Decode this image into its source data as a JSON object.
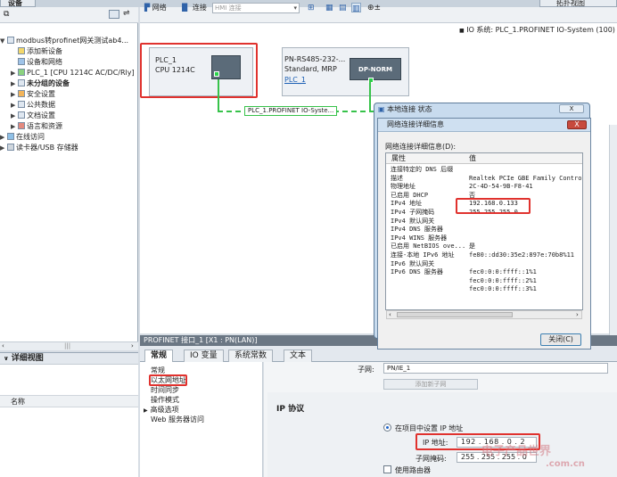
{
  "tabs": {
    "devices": "设备",
    "topology": "拓扑视图"
  },
  "tree": {
    "items": [
      {
        "label": "modbus转profinet网关测试ab4...",
        "indent": 0,
        "expander": "▼"
      },
      {
        "label": "添加新设备",
        "indent": 1,
        "expander": ""
      },
      {
        "label": "设备和网络",
        "indent": 1,
        "expander": ""
      },
      {
        "label": "PLC_1 [CPU 1214C AC/DC/Rly]",
        "indent": 1,
        "expander": "▶"
      },
      {
        "label": "未分组的设备",
        "indent": 1,
        "expander": "▶"
      },
      {
        "label": "安全设置",
        "indent": 1,
        "expander": "▶"
      },
      {
        "label": "公共数据",
        "indent": 1,
        "expander": "▶"
      },
      {
        "label": "文档设置",
        "indent": 1,
        "expander": "▶"
      },
      {
        "label": "语言和资源",
        "indent": 1,
        "expander": "▶"
      },
      {
        "label": "在线访问",
        "indent": 0,
        "expander": "▶"
      },
      {
        "label": "读卡器/USB 存储器",
        "indent": 0,
        "expander": "▶"
      }
    ]
  },
  "detail": {
    "title": "详细视图",
    "column": "名称"
  },
  "toolbar": {
    "network": "网络",
    "connections": "连接",
    "hmi_placeholder": "HMI 连接"
  },
  "io_system": "IO 系统: PLC_1.PROFINET IO-System (100)",
  "devices": {
    "plc": {
      "name": "PLC_1",
      "model": "CPU 1214C"
    },
    "dpn": {
      "name": "PN-RS485-232-...",
      "type": "Standard, MRP",
      "link": "PLC_1",
      "module": "DP-NORM"
    }
  },
  "bus_label": "PLC_1.PROFINET IO-Syste...",
  "dialog_outer": {
    "title": "本地连接 状态",
    "close": "X"
  },
  "dialog_inner": {
    "title": "网络连接详细信息",
    "close": "X",
    "caption": "网络连接详细信息(D):",
    "col_prop": "属性",
    "col_val": "值",
    "rows": [
      {
        "p": "连接特定的 DNS 后缀",
        "v": ""
      },
      {
        "p": "描述",
        "v": "Realtek PCIe GBE Family Controller"
      },
      {
        "p": "物理地址",
        "v": "2C-4D-54-9B-F8-41"
      },
      {
        "p": "已启用 DHCP",
        "v": "否"
      },
      {
        "p": "IPv4 地址",
        "v": "192.168.0.133"
      },
      {
        "p": "IPv4 子网掩码",
        "v": "255.255.255.0"
      },
      {
        "p": "IPv4 默认网关",
        "v": ""
      },
      {
        "p": "IPv4 DNS 服务器",
        "v": ""
      },
      {
        "p": "IPv4 WINS 服务器",
        "v": ""
      },
      {
        "p": "已启用 NetBIOS ove...",
        "v": "是"
      },
      {
        "p": "连接-本地 IPv6 地址",
        "v": "fe80::dd30:35e2:897e:70b8%11"
      },
      {
        "p": "IPv6 默认网关",
        "v": ""
      },
      {
        "p": "IPv6 DNS 服务器",
        "v": "fec0:0:0:ffff::1%1"
      },
      {
        "p": "",
        "v": "fec0:0:0:ffff::2%1"
      },
      {
        "p": "",
        "v": "fec0:0:0:ffff::3%1"
      }
    ],
    "close_button": "关闭(C)"
  },
  "props": {
    "title": "PROFINET 接口_1 [X1 : PN(LAN)]",
    "tabs": [
      "常规",
      "IO 变量",
      "系统常数",
      "文本"
    ],
    "nav": [
      "常规",
      "以太网地址",
      "时间同步",
      "操作模式",
      "高级选项",
      "Web 服务器访问"
    ],
    "subnet_label": "子网:",
    "subnet_value": "PN/IE_1",
    "add_subnet": "添加新子网",
    "ip_protocol": "IP 协议",
    "radio_label": "在项目中设置 IP 地址",
    "ip_label": "IP 地址:",
    "ip_value": "192 . 168 . 0 . 2",
    "mask_label": "子网掩码:",
    "mask_value": "255 . 255 . 255 . 0",
    "router_label": "使用路由器"
  },
  "watermark": {
    "line1": "电子产品世界",
    "line2": ".com.cn"
  }
}
